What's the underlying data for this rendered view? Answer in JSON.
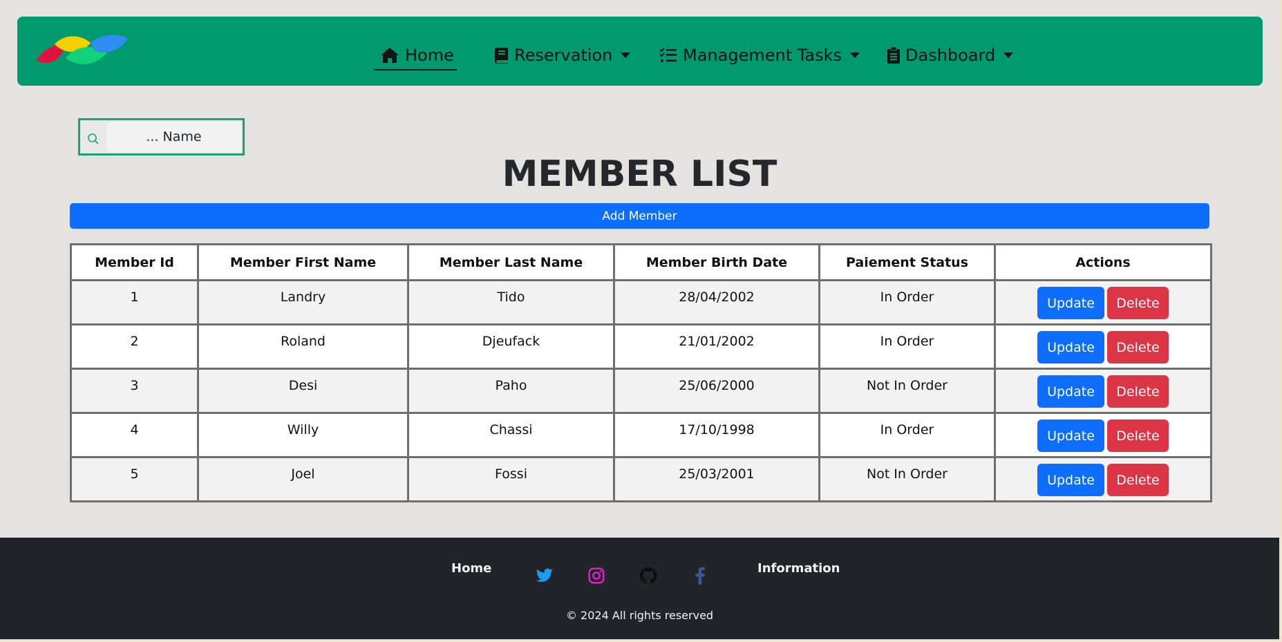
{
  "nav": {
    "items": [
      {
        "label": "Home",
        "icon": "home-icon"
      },
      {
        "label": "Reservation",
        "icon": "book-icon"
      },
      {
        "label": "Management Tasks",
        "icon": "task-list-icon"
      },
      {
        "label": "Dashboard",
        "icon": "clipboard-icon"
      }
    ]
  },
  "search": {
    "placeholder": "... Name"
  },
  "page_title": "MEMBER LIST",
  "add_button": "Add Member",
  "table": {
    "headers": [
      "Member Id",
      "Member First Name",
      "Member Last Name",
      "Member Birth Date",
      "Paiement Status",
      "Actions"
    ],
    "rows": [
      {
        "id": "1",
        "first": "Landry",
        "last": "Tido",
        "birth": "28/04/2002",
        "status": "In Order"
      },
      {
        "id": "2",
        "first": "Roland",
        "last": "Djeufack",
        "birth": "21/01/2002",
        "status": "In Order"
      },
      {
        "id": "3",
        "first": "Desi",
        "last": "Paho",
        "birth": "25/06/2000",
        "status": "Not In Order"
      },
      {
        "id": "4",
        "first": "Willy",
        "last": "Chassi",
        "birth": "17/10/1998",
        "status": "In Order"
      },
      {
        "id": "5",
        "first": "Joel",
        "last": "Fossi",
        "birth": "25/03/2001",
        "status": "Not In Order"
      }
    ],
    "update_label": "Update",
    "delete_label": "Delete"
  },
  "footer": {
    "home": "Home",
    "information": "Information",
    "social": [
      "twitter-icon",
      "instagram-icon",
      "github-icon",
      "facebook-icon"
    ],
    "copyright": "© 2024 All rights reserved"
  },
  "colors": {
    "navbar": "#009a6e",
    "primary": "#0d6efd",
    "danger": "#dc3545",
    "footer": "#212529",
    "twitter": "#1d9bf0",
    "instagram": "#e91ed1",
    "github": "#0d0d0d",
    "facebook": "#3b5998"
  }
}
